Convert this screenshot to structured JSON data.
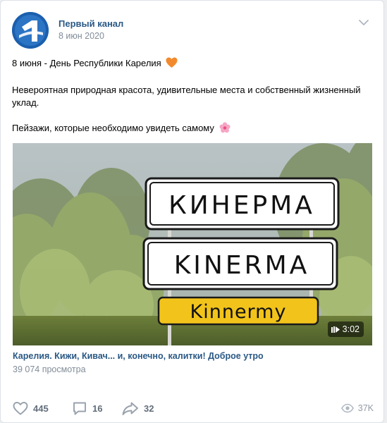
{
  "post": {
    "author": "Первый канал",
    "date": "8 июн 2020",
    "text_line1": "8 июня - День Республики Карелия",
    "text_line2": "Невероятная природная красота, удивительные места и собственный жизненный уклад.",
    "text_line3": "Пейзажи, которые необходимо увидеть самому"
  },
  "video": {
    "sign_cyrillic": "КИНЕРМА",
    "sign_latin": "KINERMA",
    "sign_finnish": "Kinnermy",
    "duration": "3:02",
    "title": "Карелия. Кижи, Кивач... и, конечно, калитки! Доброе утро",
    "views": "39 074 просмотра"
  },
  "footer": {
    "likes": "445",
    "comments": "16",
    "shares": "32",
    "views": "37K"
  },
  "icons": {
    "heart_emoji": "orange-heart-icon",
    "flower_emoji": "cherry-blossom-icon",
    "avatar_logo": "channel-one-logo"
  },
  "colors": {
    "link": "#2a5885",
    "secondary": "#818c99",
    "icon": "#99a2ad",
    "sign_yellow": "#f2c41b"
  }
}
